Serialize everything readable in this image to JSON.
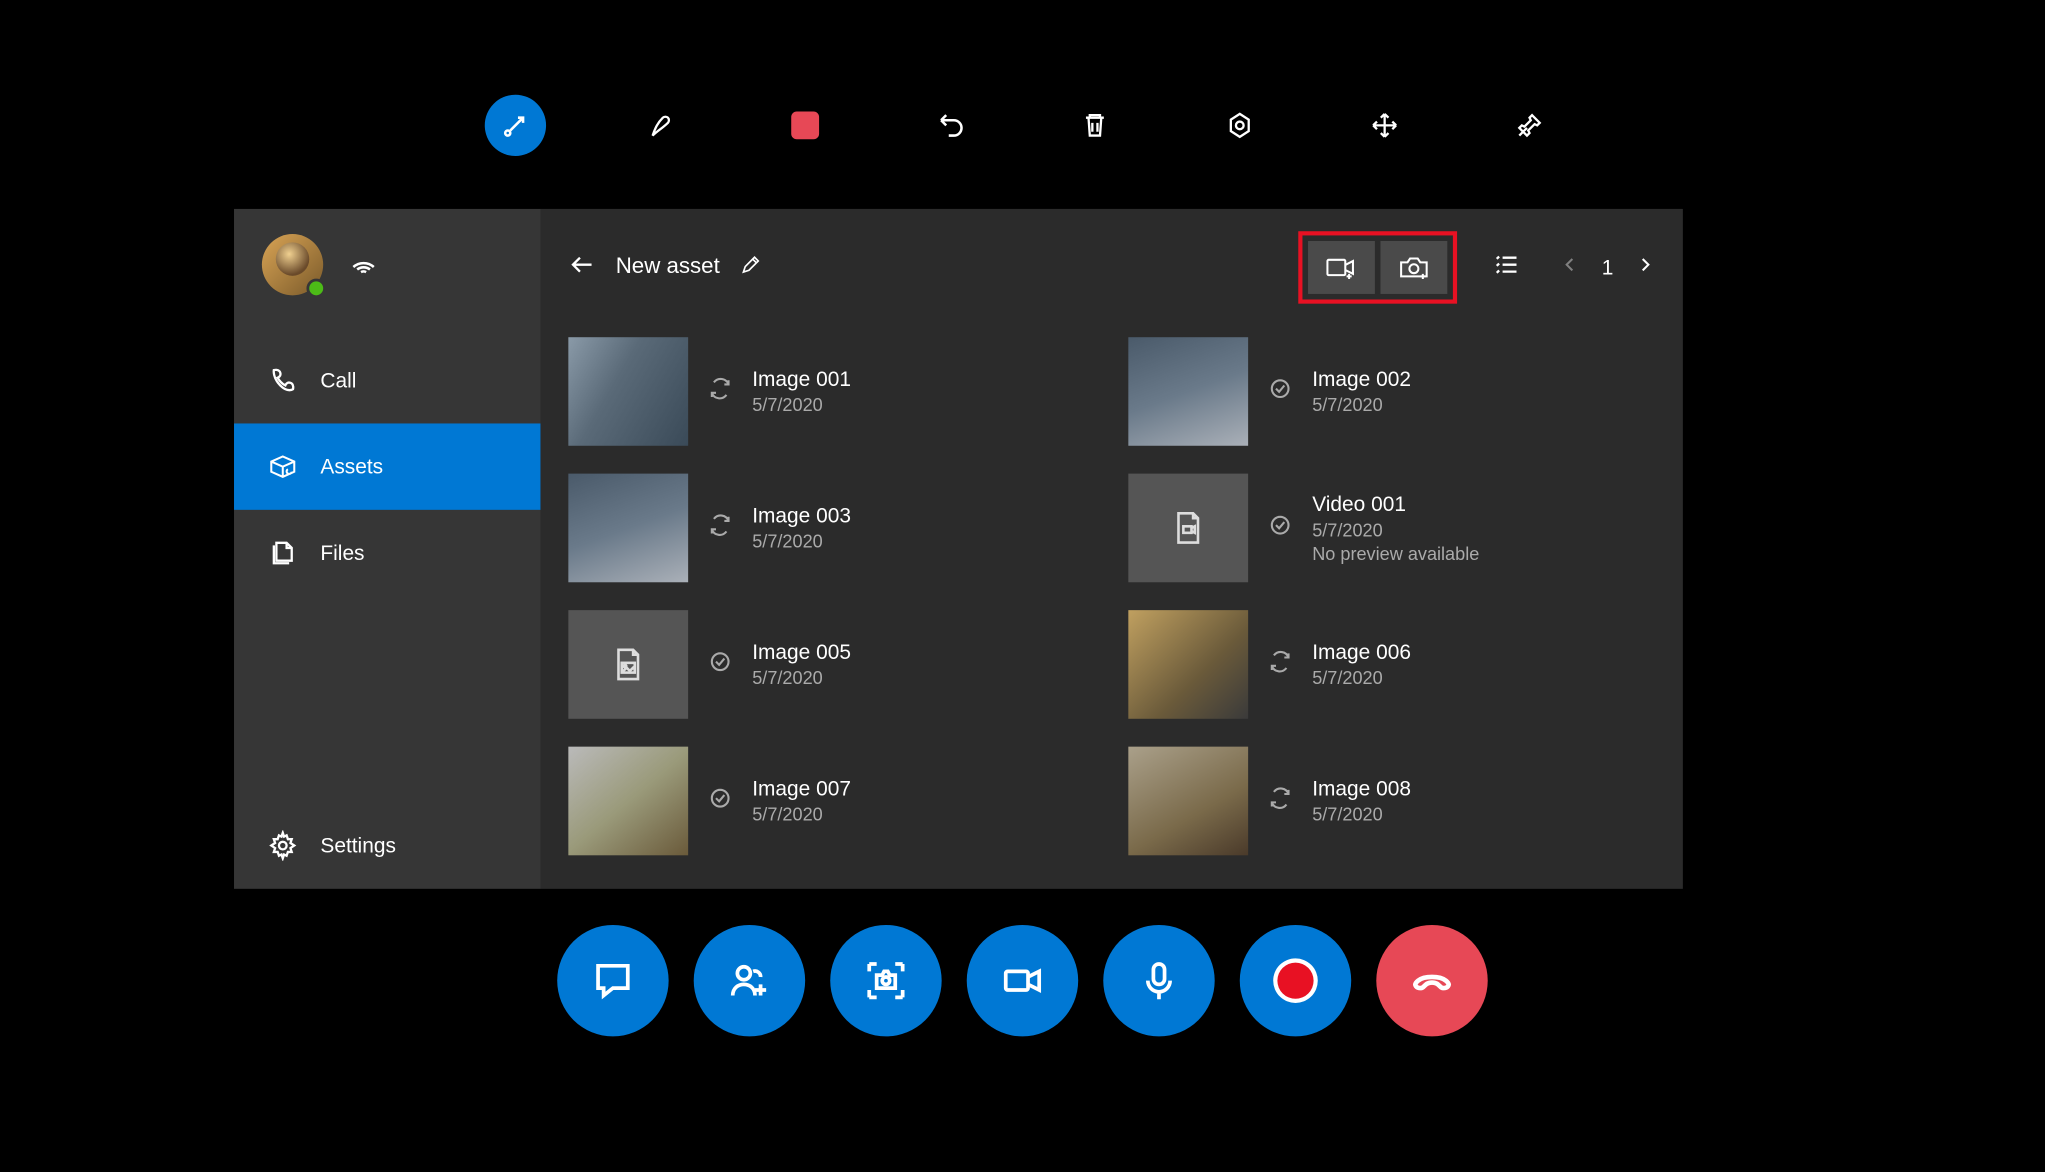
{
  "sidebar": {
    "items": [
      {
        "label": "Call"
      },
      {
        "label": "Assets"
      },
      {
        "label": "Files"
      },
      {
        "label": "Settings"
      }
    ]
  },
  "header": {
    "title": "New asset",
    "page": "1"
  },
  "assets": [
    {
      "name": "Image 001",
      "date": "5/7/2020",
      "status": "sync",
      "thumb": "img-a"
    },
    {
      "name": "Image 002",
      "date": "5/7/2020",
      "status": "done",
      "thumb": "img-b"
    },
    {
      "name": "Image 003",
      "date": "5/7/2020",
      "status": "sync",
      "thumb": "img-b"
    },
    {
      "name": "Video 001",
      "date": "5/7/2020",
      "status": "done",
      "thumb": "placeholder-video",
      "extra": "No preview available"
    },
    {
      "name": "Image 005",
      "date": "5/7/2020",
      "status": "done",
      "thumb": "placeholder-image"
    },
    {
      "name": "Image 006",
      "date": "5/7/2020",
      "status": "sync",
      "thumb": "img-c"
    },
    {
      "name": "Image 007",
      "date": "5/7/2020",
      "status": "done",
      "thumb": "img-e"
    },
    {
      "name": "Image 008",
      "date": "5/7/2020",
      "status": "sync",
      "thumb": "img-d"
    }
  ]
}
